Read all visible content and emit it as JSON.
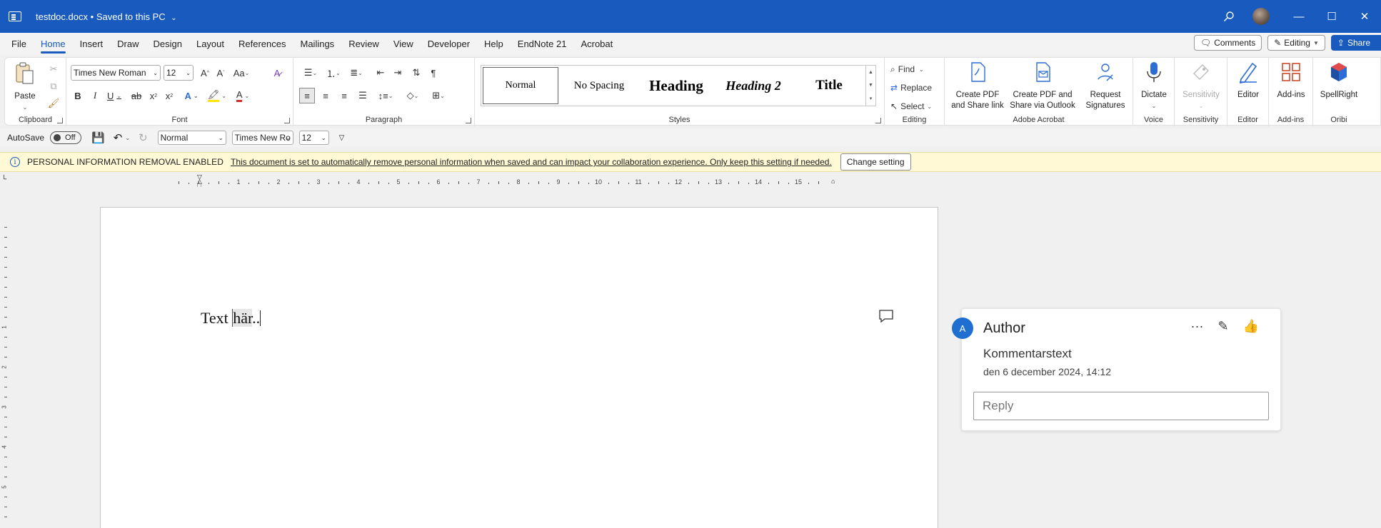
{
  "titlebar": {
    "doc_name": "testdoc.docx",
    "separator": "•",
    "save_status": "Saved to this PC"
  },
  "menu": {
    "tabs": [
      "File",
      "Home",
      "Insert",
      "Draw",
      "Design",
      "Layout",
      "References",
      "Mailings",
      "Review",
      "View",
      "Developer",
      "Help",
      "EndNote 21",
      "Acrobat"
    ],
    "active_tab": "Home",
    "comments_label": "Comments",
    "editing_label": "Editing",
    "share_label": "Share"
  },
  "ribbon": {
    "clipboard": {
      "label": "Clipboard",
      "paste_label": "Paste"
    },
    "font": {
      "label": "Font",
      "font_name": "Times New Roman",
      "font_size": "12"
    },
    "paragraph": {
      "label": "Paragraph"
    },
    "styles": {
      "label": "Styles",
      "items": [
        "Normal",
        "No Spacing",
        "Heading",
        "Heading 2",
        "Title"
      ]
    },
    "editing": {
      "label": "Editing",
      "find": "Find",
      "replace": "Replace",
      "select": "Select"
    },
    "acrobat": {
      "label": "Adobe Acrobat",
      "create_pdf_share_1": "Create PDF",
      "create_pdf_share_2": "and Share link",
      "create_pdf_outlook_1": "Create PDF and",
      "create_pdf_outlook_2": "Share via Outlook",
      "request_sig_1": "Request",
      "request_sig_2": "Signatures"
    },
    "voice": {
      "label": "Voice",
      "dictate": "Dictate"
    },
    "sensitivity": {
      "label": "Sensitivity",
      "button": "Sensitivity"
    },
    "editor": {
      "label": "Editor",
      "button": "Editor"
    },
    "addins": {
      "label": "Add-ins",
      "button": "Add-ins"
    },
    "oribi": {
      "label": "Oribi",
      "button": "SpellRight"
    }
  },
  "qat": {
    "autosave_label": "AutoSave",
    "autosave_state": "Off",
    "style_value": "Normal",
    "font_value": "Times New Ro",
    "size_value": "12"
  },
  "infobar": {
    "title": "PERSONAL INFORMATION REMOVAL ENABLED",
    "message": "This document is set to automatically remove personal information when saved and can impact your collaboration experience. Only keep this setting if needed.",
    "button": "Change setting"
  },
  "ruler": {
    "numbers": [
      "1",
      "2",
      "3",
      "4",
      "5",
      "6",
      "7",
      "8",
      "9",
      "10",
      "11",
      "12",
      "13",
      "14",
      "15"
    ],
    "vnumbers": [
      "1",
      "2",
      "3",
      "4",
      "5"
    ]
  },
  "document": {
    "text_before": "Text ",
    "text_highlight": "här",
    "text_after": ".."
  },
  "comment": {
    "avatar_initial": "A",
    "author": "Author",
    "text": "Kommentarstext",
    "date": "den 6 december 2024, 14:12",
    "reply_placeholder": "Reply",
    "more": "···"
  }
}
